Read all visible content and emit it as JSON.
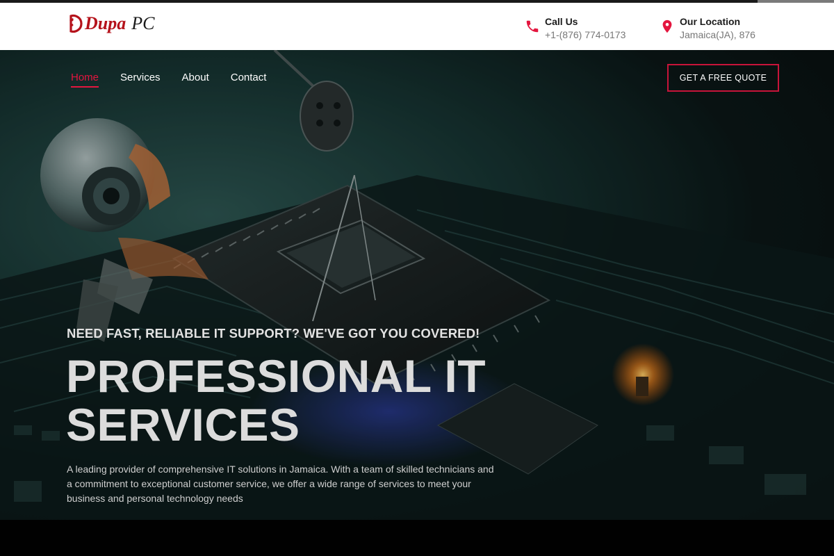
{
  "brand": {
    "logo_part1": "Dupa",
    "logo_part2": "PC",
    "accent_color": "#b5121b",
    "nav_active_color": "#e4163f"
  },
  "header": {
    "call": {
      "title": "Call Us",
      "value": "+1-(876) 774-0173",
      "icon": "phone-icon"
    },
    "location": {
      "title": "Our Location",
      "value": "Jamaica(JA), 876",
      "icon": "map-pin-icon"
    }
  },
  "nav": {
    "items": [
      {
        "label": "Home",
        "active": true
      },
      {
        "label": "Services",
        "active": false
      },
      {
        "label": "About",
        "active": false
      },
      {
        "label": "Contact",
        "active": false
      }
    ],
    "cta_label": "GET A FREE QUOTE"
  },
  "hero": {
    "kicker": "NEED FAST, RELIABLE IT SUPPORT? WE'VE GOT YOU COVERED!",
    "title": "PROFESSIONAL IT SERVICES",
    "description": "A leading provider of comprehensive IT solutions in Jamaica. With a team of skilled technicians and a commitment to exceptional customer service, we offer a wide range of services to meet your business and personal technology needs",
    "background_image": "robot-circuit-board-image"
  }
}
